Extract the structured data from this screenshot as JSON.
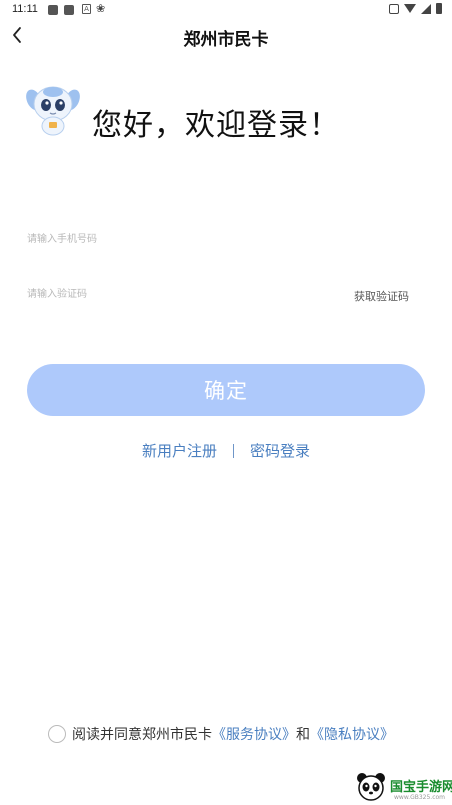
{
  "status_bar": {
    "time": "11:11"
  },
  "nav": {
    "title": "郑州市民卡"
  },
  "greeting": {
    "text": "您好，欢迎登录！"
  },
  "form": {
    "phone_placeholder": "请输入手机号码",
    "code_placeholder": "请输入验证码",
    "get_code_label": "获取验证码",
    "confirm_label": "确定"
  },
  "links": {
    "register": "新用户注册",
    "password_login": "密码登录"
  },
  "agreement": {
    "prefix": "阅读并同意郑州市民卡",
    "service": "《服务协议》",
    "and": "和",
    "privacy": "《隐私协议》"
  },
  "watermark": {
    "text": "国宝手游网",
    "sub": "www.GB325.com"
  },
  "colors": {
    "button_bg": "#aec9fb",
    "link": "#4a7fc0"
  }
}
